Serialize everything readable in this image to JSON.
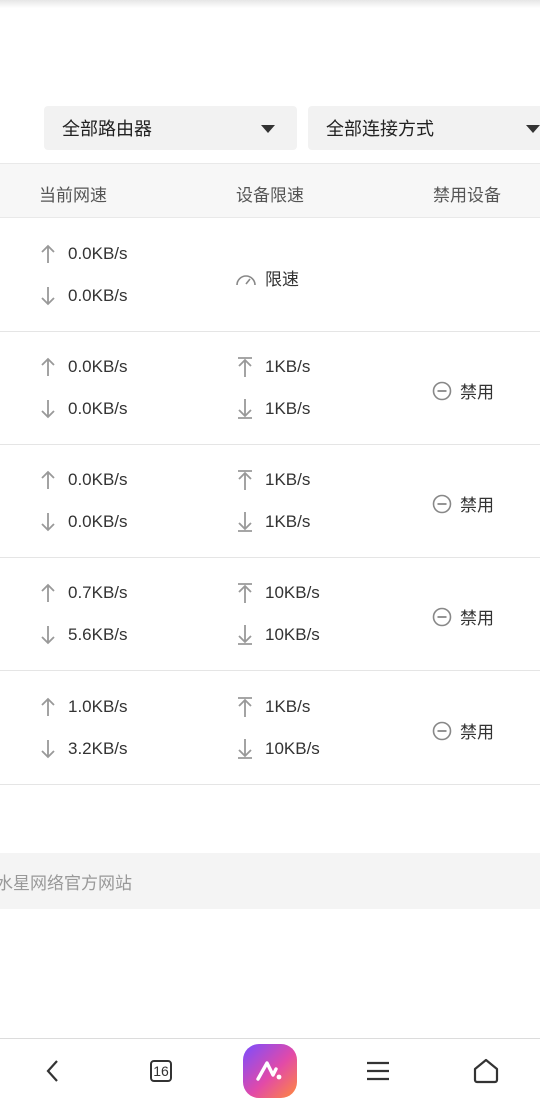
{
  "filters": {
    "router": "全部路由器",
    "connection": "全部连接方式"
  },
  "table": {
    "headers": {
      "speed": "当前网速",
      "limit": "设备限速",
      "disable": "禁用设备"
    },
    "rows": [
      {
        "up": "0.0KB/s",
        "down": "0.0KB/s",
        "limit_label": "限速"
      },
      {
        "up": "0.0KB/s",
        "down": "0.0KB/s",
        "limit_up": "1KB/s",
        "limit_down": "1KB/s",
        "disable_label": "禁用"
      },
      {
        "up": "0.0KB/s",
        "down": "0.0KB/s",
        "limit_up": "1KB/s",
        "limit_down": "1KB/s",
        "disable_label": "禁用"
      },
      {
        "up": "0.7KB/s",
        "down": "5.6KB/s",
        "limit_up": "10KB/s",
        "limit_down": "10KB/s",
        "disable_label": "禁用"
      },
      {
        "up": "1.0KB/s",
        "down": "3.2KB/s",
        "limit_up": "1KB/s",
        "limit_down": "10KB/s",
        "disable_label": "禁用"
      }
    ]
  },
  "footer": {
    "link": "水星网络官方网站"
  },
  "navbar": {
    "tab_count": "16",
    "icons": [
      "back-icon",
      "tabs-icon",
      "browser-app-icon",
      "menu-icon",
      "home-icon"
    ]
  }
}
